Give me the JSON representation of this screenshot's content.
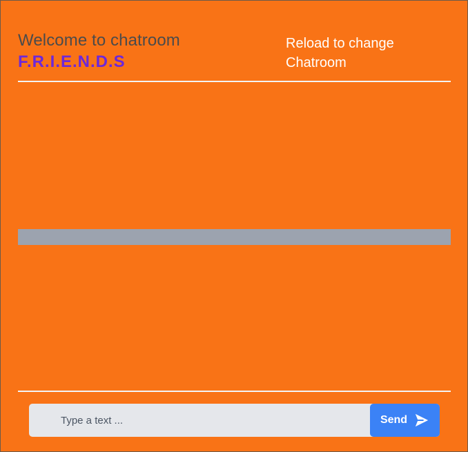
{
  "header": {
    "welcome_text": "Welcome to chatroom",
    "room_name": "F.R.I.E.N.D.S",
    "reload_note_line1": "Reload to change",
    "reload_note_line2": "Chatroom"
  },
  "composer": {
    "input_placeholder": "Type a text ...",
    "input_value": "",
    "send_label": "Send",
    "send_icon": "paper-plane-icon"
  },
  "colors": {
    "background": "#f97316",
    "room_name": "#6d28d9",
    "send_button": "#3b82f6",
    "input_background": "#e5e7eb",
    "message_bar": "#9ca3af"
  }
}
